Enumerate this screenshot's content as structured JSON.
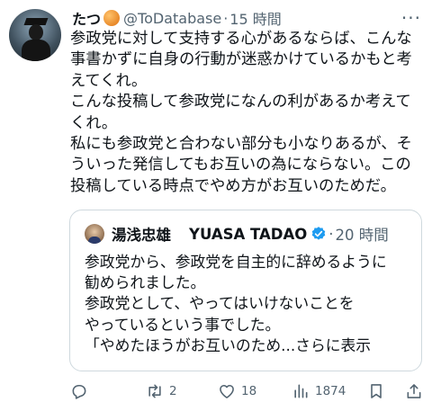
{
  "tweet": {
    "display_name": "たつ",
    "handle": "@ToDatabase",
    "dot": "·",
    "time": "15 時間",
    "more": "···",
    "lines": [
      "参政党に対して支持する心があるならば、こんな",
      "事書かずに自身の行動が迷惑かけているかもと考",
      "えてくれ。",
      "こんな投稿して参政党になんの利があるか考えて",
      "くれ。",
      "私にも参政党と合わない部分も小なりあるが、そ",
      "ういった発信してもお互いの為にならない。この",
      "投稿している時点でやめ方がお互いのためだ。"
    ]
  },
  "quote": {
    "name_ja": "湯浅忠雄",
    "name_en": "YUASA TADAO",
    "dot": "·",
    "time": "20 時間",
    "lines": [
      "参政党から、参政党を自主的に辞めるように",
      "勧められました。",
      "参政党として、やってはいけないことを",
      "やっているという事でした。"
    ],
    "last_line": "「やめたほうがお互いのため...",
    "show_more": "さらに表示"
  },
  "actions": {
    "reply_icon": "reply-icon",
    "retweet_icon": "retweet-icon",
    "retweet_count": "2",
    "like_icon": "heart-icon",
    "like_count": "18",
    "views_icon": "views-icon",
    "views_count": "1874",
    "bookmark_icon": "bookmark-icon",
    "share_icon": "share-icon"
  },
  "colors": {
    "text": "#0f1419",
    "secondary": "#536471",
    "border": "#cfd9de",
    "verified": "#1d9bf0"
  }
}
